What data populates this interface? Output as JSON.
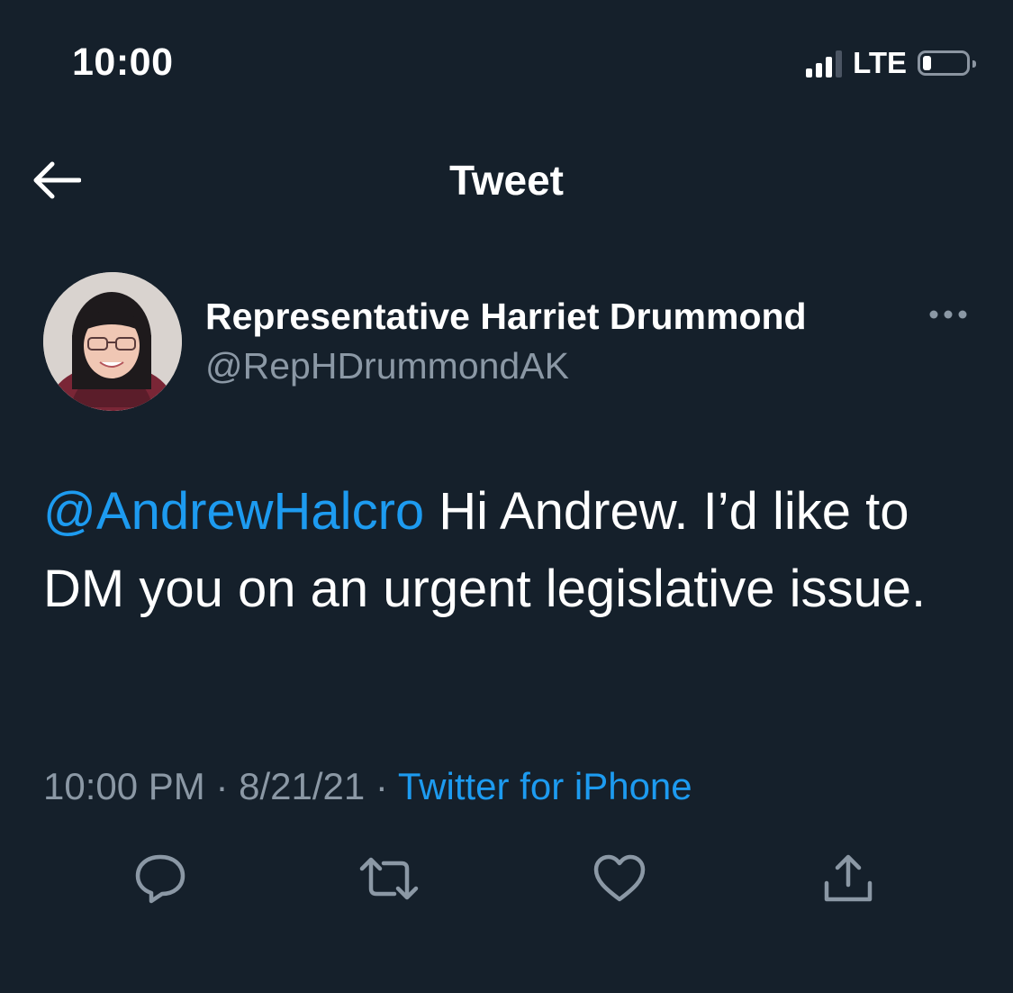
{
  "status_bar": {
    "time": "10:00",
    "network": "LTE"
  },
  "header": {
    "title": "Tweet",
    "back_icon": "arrow-left-icon"
  },
  "tweet": {
    "author_name": "Representative Harriet Drummond",
    "author_handle": "@RepHDrummondAK",
    "mention": "@AndrewHalcro",
    "text": " Hi Andrew. I’d like to DM you on an urgent legislative issue.",
    "time": "10:00 PM",
    "separator": " · ",
    "date": "8/21/21",
    "source": "Twitter for iPhone"
  },
  "actions": {
    "reply_icon": "reply-icon",
    "retweet_icon": "retweet-icon",
    "like_icon": "heart-icon",
    "share_icon": "share-icon"
  },
  "colors": {
    "background": "#15202b",
    "accent": "#1d9bf0",
    "secondary_text": "#8b98a5",
    "primary_text": "#ffffff"
  }
}
